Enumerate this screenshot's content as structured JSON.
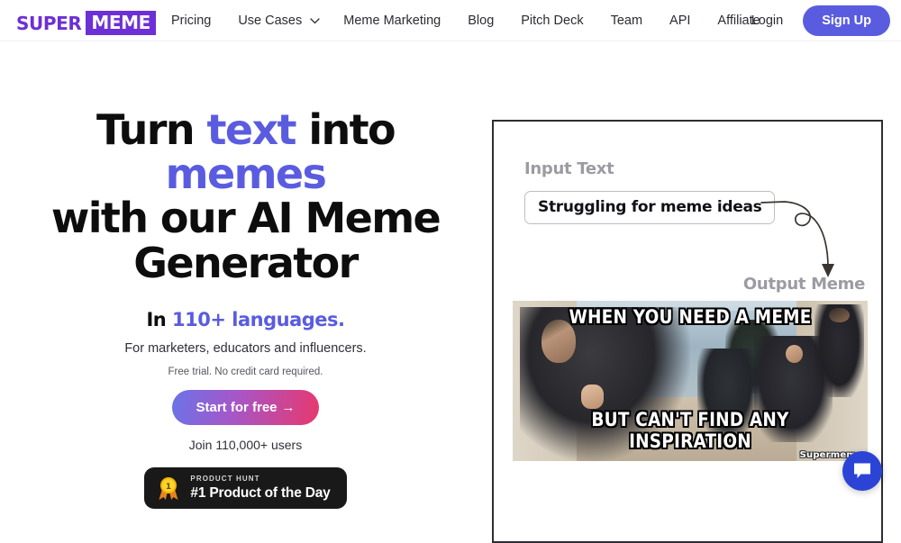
{
  "nav": {
    "logo": {
      "part1": "SUPER",
      "part2": "MEME"
    },
    "links": [
      {
        "label": "Pricing",
        "caret": false
      },
      {
        "label": "Use Cases",
        "caret": true
      },
      {
        "label": "Meme Marketing",
        "caret": false
      },
      {
        "label": "Blog",
        "caret": false
      },
      {
        "label": "Pitch Deck",
        "caret": false
      },
      {
        "label": "Team",
        "caret": false
      },
      {
        "label": "API",
        "caret": false
      },
      {
        "label": "Affiliate",
        "caret": false
      }
    ],
    "login_label": "Login",
    "signup_label": "Sign Up",
    "caret_icon": "chevron-down-icon"
  },
  "hero": {
    "headline": {
      "line1_a": "Turn ",
      "line1_accent1": "text",
      "line1_b": " into ",
      "line1_accent2": "memes",
      "line2": "with our AI Meme",
      "line3": "Generator"
    },
    "language_prefix": "In ",
    "language_accent": "110+ languages.",
    "subline": "For marketers, educators and influencers.",
    "microline": "Free trial. No credit card required.",
    "cta_label": "Start for free",
    "cta_arrow": "→",
    "joinline": "Join 110,000+ users",
    "product_hunt": {
      "kicker": "PRODUCT HUNT",
      "title": "#1 Product of the Day",
      "medal_icon": "medal-icon",
      "medal_number": "1"
    }
  },
  "demo": {
    "input_label": "Input Text",
    "input_value": "Struggling for meme ideas",
    "output_label": "Output Meme",
    "arrow_icon": "curved-arrow-icon",
    "meme": {
      "top_text": "WHEN YOU NEED A MEME",
      "bottom_text": "BUT CAN'T FIND ANY INSPIRATION",
      "watermark": "Supermeme"
    }
  },
  "chat": {
    "icon": "chat-bubble-icon"
  },
  "colors": {
    "brand_purple": "#6d2fd6",
    "accent_indigo": "#5a5ce0",
    "cta_gradient_start": "#6a74e8",
    "cta_gradient_end": "#e8386d",
    "badge_bg": "#191919",
    "chat_blue": "#2b44d6",
    "panel_border": "#2d2d33",
    "muted_label": "#9b9ba3"
  }
}
